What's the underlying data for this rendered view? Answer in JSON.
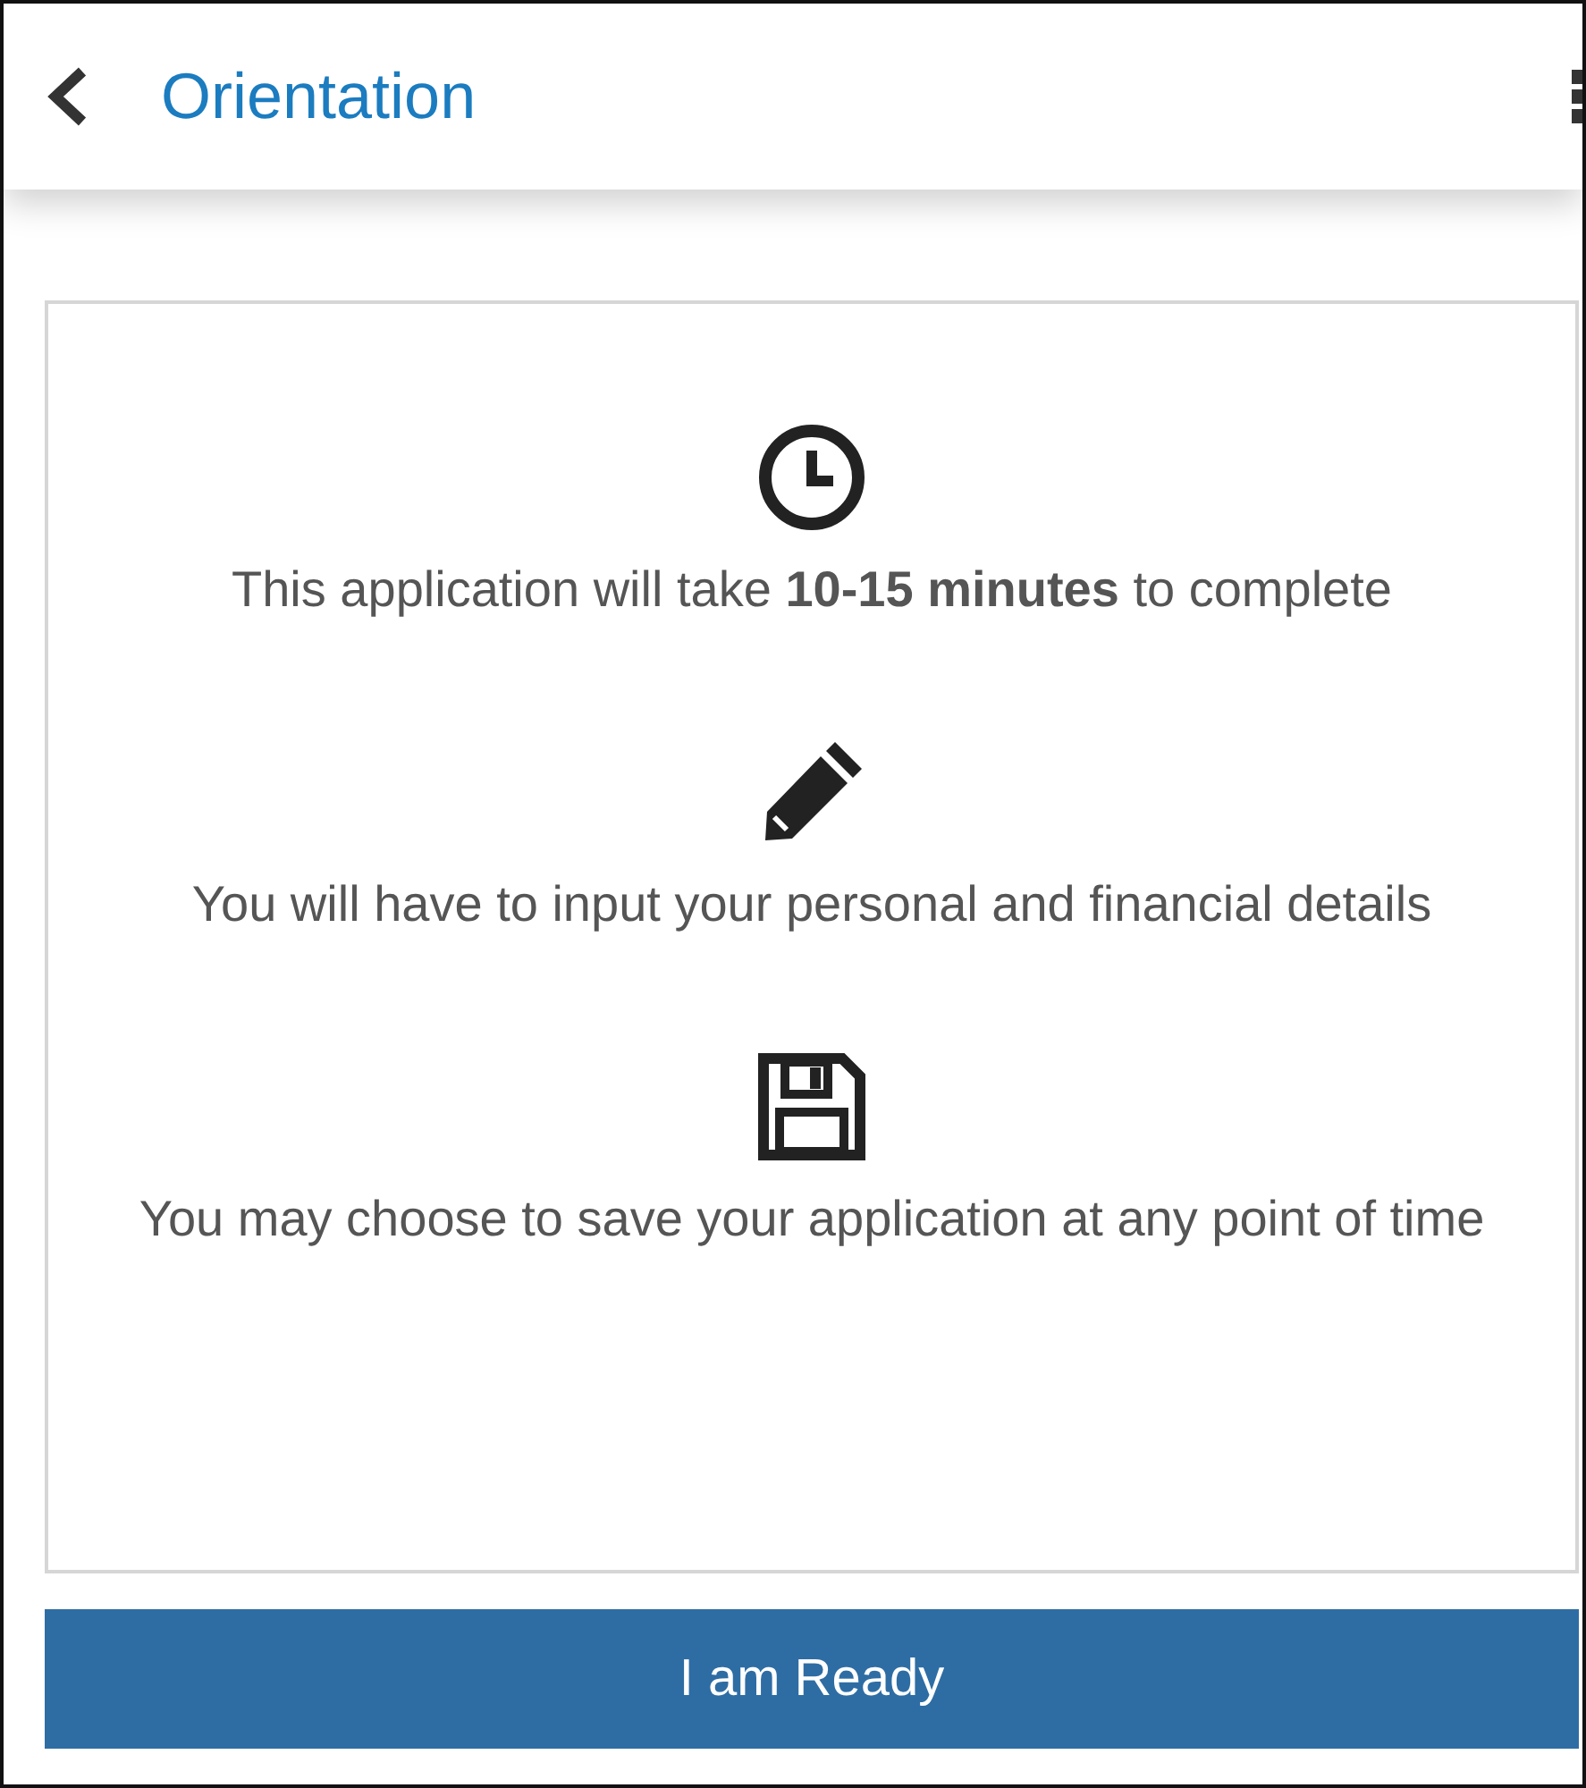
{
  "header": {
    "title": "Orientation"
  },
  "items": [
    {
      "kind": "clock",
      "text": "This application will take **10-15 minutes** to complete"
    },
    {
      "kind": "pencil",
      "text": "You will have to input your personal and financial details"
    },
    {
      "kind": "save",
      "text": "You may choose to save your application at any point of time"
    }
  ],
  "button": {
    "label": "I am Ready"
  }
}
